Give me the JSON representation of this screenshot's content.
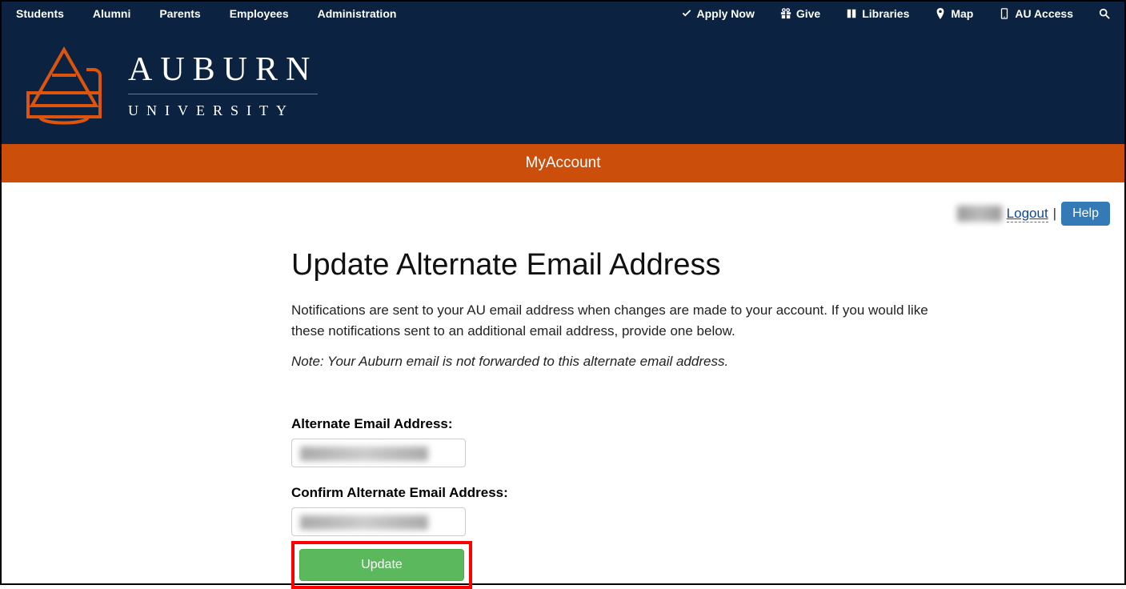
{
  "topnav": {
    "left": [
      "Students",
      "Alumni",
      "Parents",
      "Employees",
      "Administration"
    ],
    "right": [
      {
        "icon": "check",
        "label": "Apply Now"
      },
      {
        "icon": "gift",
        "label": "Give"
      },
      {
        "icon": "book",
        "label": "Libraries"
      },
      {
        "icon": "pin",
        "label": "Map"
      },
      {
        "icon": "phone",
        "label": "AU Access"
      },
      {
        "icon": "search",
        "label": ""
      }
    ]
  },
  "brand": {
    "name_top": "AUBURN",
    "name_bottom": "UNIVERSITY"
  },
  "orange_bar": {
    "title": "MyAccount"
  },
  "user_bar": {
    "logout": "Logout",
    "separator": "|",
    "help": "Help"
  },
  "page": {
    "title": "Update Alternate Email Address",
    "description": "Notifications are sent to your AU email address when changes are made to your account. If you would like these notifications sent to an additional email address, provide one below.",
    "note": "Note: Your Auburn email is not forwarded to this alternate email address."
  },
  "form": {
    "label1": "Alternate Email Address:",
    "label2": "Confirm Alternate Email Address:",
    "update": "Update"
  }
}
